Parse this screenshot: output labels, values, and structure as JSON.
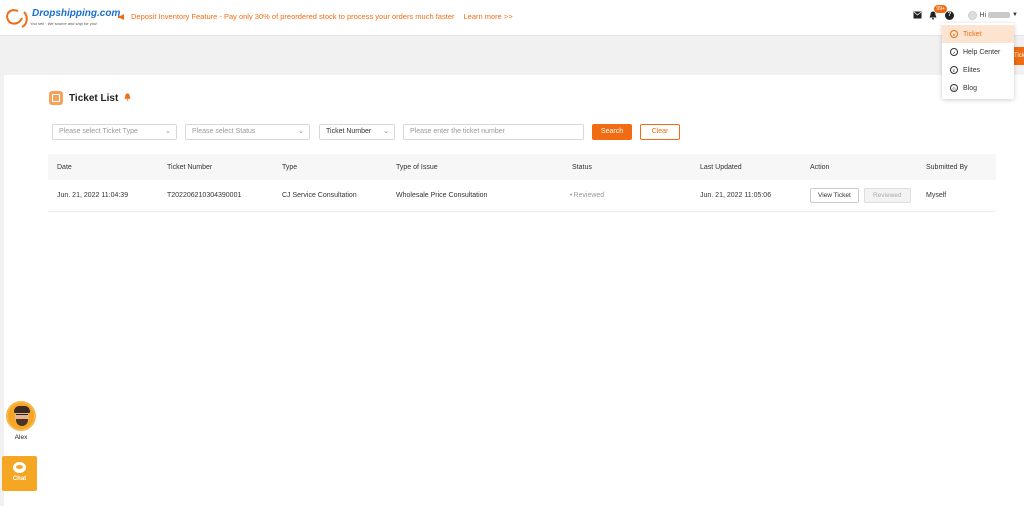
{
  "brand": {
    "logo_text": "Dropshipping.com",
    "tagline": "You sell · We source and ship for you!"
  },
  "announcement": {
    "text": "Deposit Inventory Feature - Pay only 30% of preordered stock to process your orders much faster",
    "link": "Learn more >>"
  },
  "header": {
    "notification_badge": "99+",
    "greeting": "Hi"
  },
  "dropdown": {
    "items": [
      {
        "label": "Ticket",
        "icon": "ticket-icon",
        "active": true
      },
      {
        "label": "Help Center",
        "icon": "compass-icon",
        "active": false
      },
      {
        "label": "Elites",
        "icon": "elites-icon",
        "active": false
      },
      {
        "label": "Blog",
        "icon": "blog-icon",
        "active": false
      }
    ],
    "side_tab": "Ticket"
  },
  "page": {
    "title": "Ticket List"
  },
  "filters": {
    "ticket_type_placeholder": "Please select Ticket Type",
    "status_placeholder": "Please select Status",
    "search_field_select": "Ticket Number",
    "ticket_number_placeholder": "Please enter the ticket number",
    "search_label": "Search",
    "clear_label": "Clear"
  },
  "table": {
    "columns": [
      "Date",
      "Ticket Number",
      "Type",
      "Type of Issue",
      "Status",
      "Last Updated",
      "Action",
      "Submitted By"
    ],
    "rows": [
      {
        "date": "Jun. 21, 2022 11:04:39",
        "ticket_number": "T202206210304390001",
        "type": "CJ Service Consultation",
        "issue": "Wholesale Price Consultation",
        "status": "Reviewed",
        "last_updated": "Jun. 21, 2022 11:05:06",
        "view_label": "View Ticket",
        "reviewed_label": "Reviewed",
        "submitted_by": "Myself"
      }
    ]
  },
  "widgets": {
    "agent_name": "Alex",
    "chat_label": "Chat"
  },
  "colors": {
    "accent": "#f16b12",
    "brand_blue": "#1a6fd1"
  }
}
